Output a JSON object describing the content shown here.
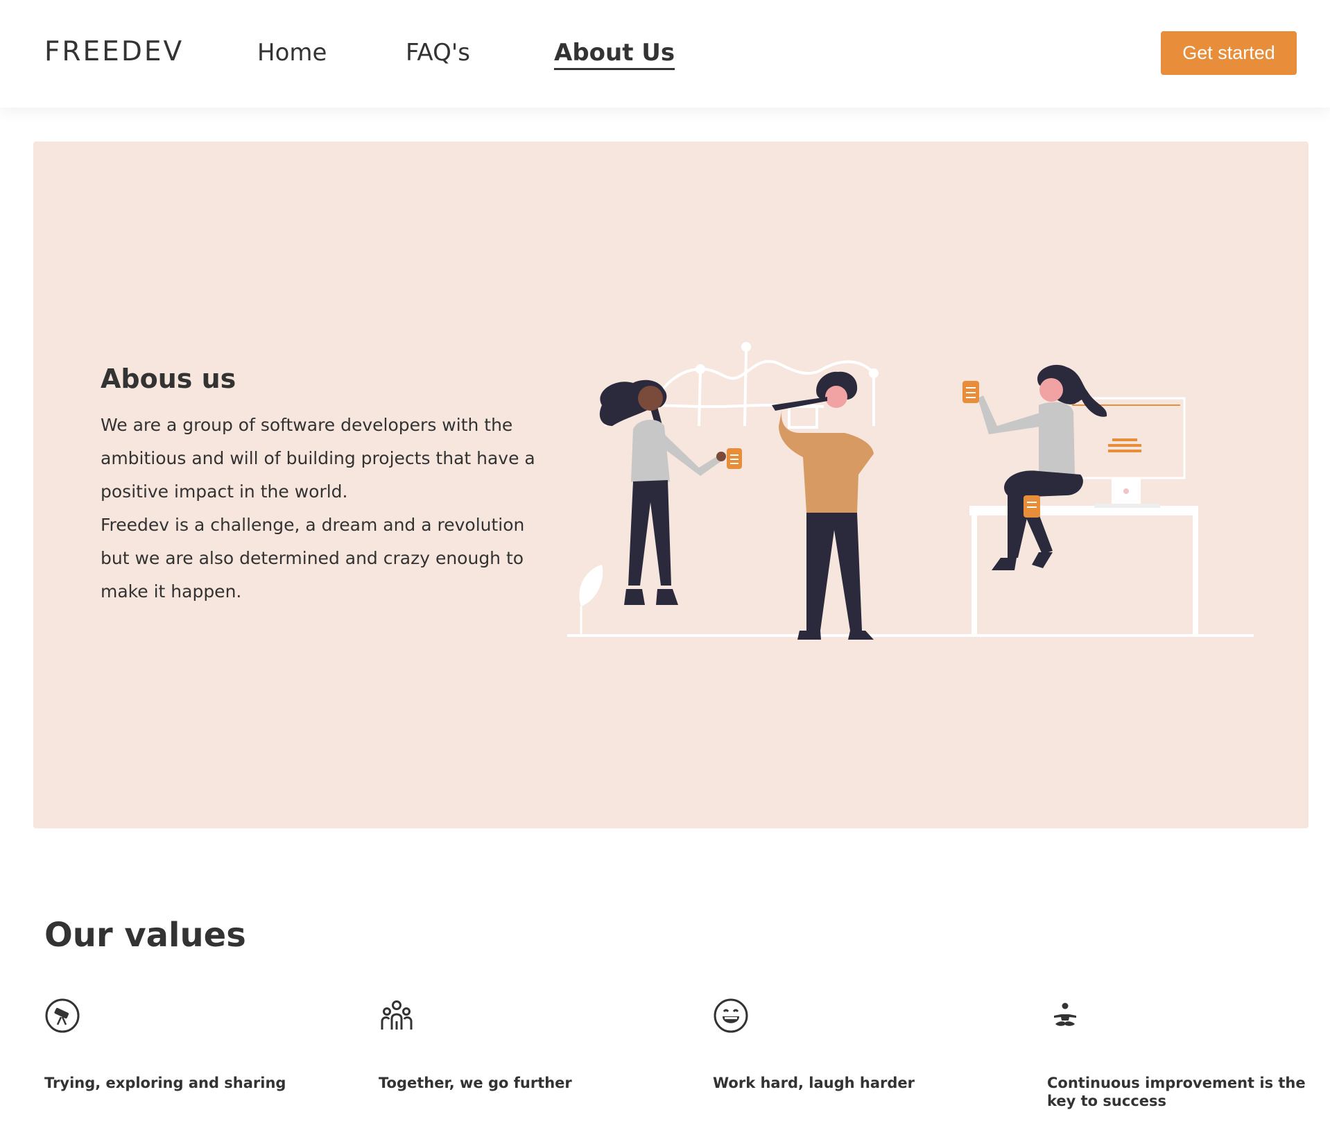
{
  "nav": {
    "logo": "FREEDEV",
    "links": [
      {
        "label": "Home"
      },
      {
        "label": "FAQ's"
      },
      {
        "label": "About Us"
      }
    ],
    "cta": "Get started"
  },
  "hero": {
    "title": "Abous us",
    "paragraph1": "We are a group of software developers with the ambitious and will of building projects that have a positive impact in the world.",
    "paragraph2": "Freedev is a challenge, a dream and a revolution but we are also determined and crazy enough to make it happen."
  },
  "values": {
    "title": "Our values",
    "items": [
      {
        "icon": "telescope-icon",
        "heading": "Trying, exploring and sharing"
      },
      {
        "icon": "people-group-icon",
        "heading": "Together, we go further"
      },
      {
        "icon": "laughing-face-icon",
        "heading": "Work hard, laugh harder"
      },
      {
        "icon": "meditation-icon",
        "heading": "Continuous improvement is the key to success"
      }
    ]
  },
  "colors": {
    "accent": "#e88d3a",
    "hero_background": "#f6e6dd",
    "text": "#333333"
  }
}
